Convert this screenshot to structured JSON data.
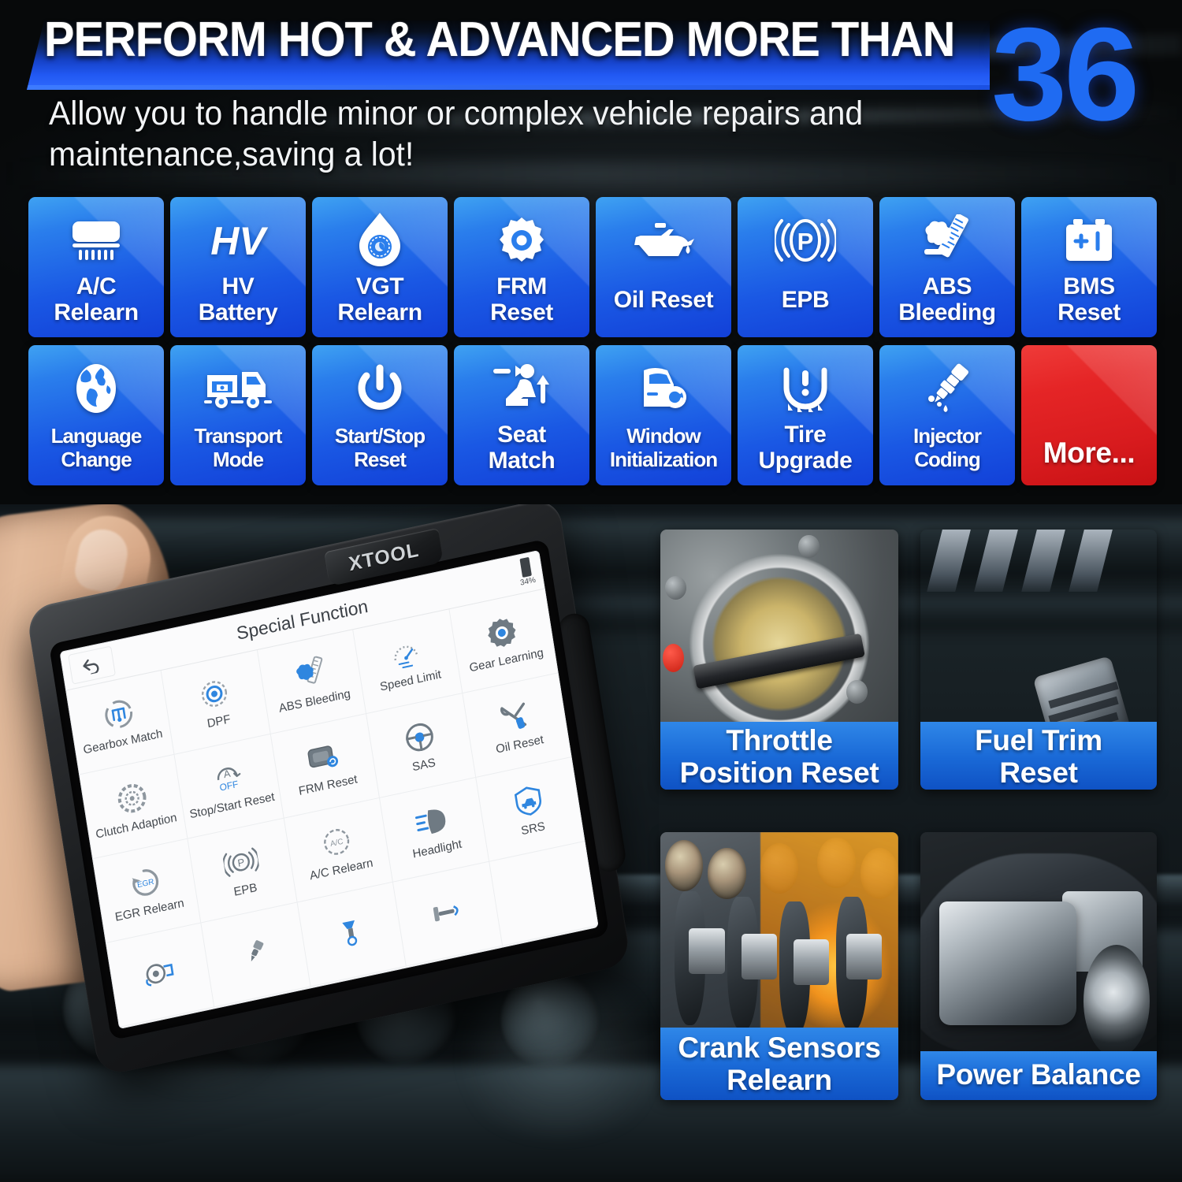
{
  "header": {
    "title": "PERFORM HOT & ADVANCED MORE THAN",
    "number": "36",
    "subtitle": "Allow you to handle minor or complex vehicle repairs and maintenance,saving a lot!",
    "accent_blue": "#1f6bf2",
    "banner_gradient_end": "#2f6bff"
  },
  "features": {
    "tile_blue_top": "#3fa2f2",
    "tile_blue_bottom": "#1240d8",
    "tile_red": "#d81b1e",
    "items": [
      {
        "label": "A/C\nRelearn",
        "icon": "air-conditioner-icon"
      },
      {
        "label": "HV\nBattery",
        "icon": "hv-text-icon"
      },
      {
        "label": "VGT\nRelearn",
        "icon": "turbo-droplet-icon"
      },
      {
        "label": "FRM\nReset",
        "icon": "gear-icon"
      },
      {
        "label": "Oil Reset",
        "icon": "oil-can-icon"
      },
      {
        "label": "EPB",
        "icon": "parking-brake-icon"
      },
      {
        "label": "ABS\nBleeding",
        "icon": "abs-bleeding-icon"
      },
      {
        "label": "BMS\nReset",
        "icon": "battery-icon"
      },
      {
        "label": "Language\nChange",
        "icon": "globe-icon"
      },
      {
        "label": "Transport\nMode",
        "icon": "truck-icon"
      },
      {
        "label": "Start/Stop\nReset",
        "icon": "power-icon"
      },
      {
        "label": "Seat\nMatch",
        "icon": "seat-icon"
      },
      {
        "label": "Window\nInitialization",
        "icon": "car-door-icon"
      },
      {
        "label": "Tire\nUpgrade",
        "icon": "tpms-icon"
      },
      {
        "label": "Injector\nCoding",
        "icon": "injector-icon"
      },
      {
        "label": "More...",
        "icon": "none"
      }
    ]
  },
  "device": {
    "brand": "XTOOL",
    "screen": {
      "title": "Special Function",
      "back_icon": "back-arrow-icon",
      "battery_percent": "34%",
      "functions": [
        {
          "label": "Gearbox Match",
          "icon": "gearbox-icon"
        },
        {
          "label": "DPF",
          "icon": "dpf-icon"
        },
        {
          "label": "ABS Bleeding",
          "icon": "abs-bleeding-icon"
        },
        {
          "label": "Speed Limit",
          "icon": "speedometer-icon"
        },
        {
          "label": "Gear Learning",
          "icon": "gear-icon"
        },
        {
          "label": "Clutch Adaption",
          "icon": "clutch-icon"
        },
        {
          "label": "Stop/Start Reset",
          "icon": "auto-off-icon"
        },
        {
          "label": "FRM Reset",
          "icon": "frm-module-icon"
        },
        {
          "label": "SAS",
          "icon": "steering-wheel-icon"
        },
        {
          "label": "Oil Reset",
          "icon": "wrench-screwdriver-icon"
        },
        {
          "label": "EGR Relearn",
          "icon": "egr-icon"
        },
        {
          "label": "EPB",
          "icon": "parking-brake-icon"
        },
        {
          "label": "A/C Relearn",
          "icon": "ac-circle-icon"
        },
        {
          "label": "Headlight",
          "icon": "headlight-icon"
        },
        {
          "label": "SRS",
          "icon": "airbag-shield-icon"
        },
        {
          "label": "",
          "icon": "turbo-icon"
        },
        {
          "label": "",
          "icon": "injector-icon"
        },
        {
          "label": "",
          "icon": "suspension-icon"
        },
        {
          "label": "",
          "icon": "tool-icon"
        },
        {
          "label": "",
          "icon": "blank-icon"
        }
      ]
    }
  },
  "photos": [
    {
      "caption": "Throttle\nPosition Reset",
      "subject": "throttle-body-photo"
    },
    {
      "caption": "Fuel Trim\nReset",
      "subject": "combustion-chamber-photo"
    },
    {
      "caption": "Crank Sensors\nRelearn",
      "subject": "crankshaft-oil-photo"
    },
    {
      "caption": "Power Balance",
      "subject": "car-engine-cutaway-photo"
    }
  ]
}
